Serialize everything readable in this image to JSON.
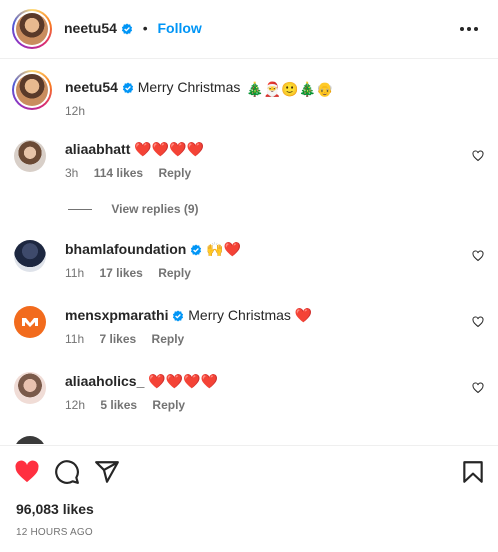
{
  "header": {
    "username": "neetu54",
    "separator": "•",
    "follow_label": "Follow",
    "more_icon": "more-horizontal-icon"
  },
  "caption": {
    "username": "neetu54",
    "text": "Merry Christmas",
    "emojis": "🎄🎅🙂🎄👴",
    "time": "12h"
  },
  "comments": [
    {
      "username": "aliaabhatt",
      "text": "❤️❤️❤️❤️",
      "time": "3h",
      "likes": "114 likes",
      "reply": "Reply"
    },
    {
      "username": "bhamlafoundation",
      "verified": true,
      "text": "🙌❤️",
      "time": "11h",
      "likes": "17 likes",
      "reply": "Reply"
    },
    {
      "username": "mensxpmarathi",
      "verified": true,
      "text": "Merry Christmas ❤️",
      "time": "11h",
      "likes": "7 likes",
      "reply": "Reply"
    },
    {
      "username": "aliaaholics_",
      "text": "❤️❤️❤️❤️",
      "time": "12h",
      "likes": "5 likes",
      "reply": "Reply"
    }
  ],
  "view_replies": "View replies (9)",
  "actions": {
    "like_icon": "heart-filled-icon",
    "comment_icon": "comment-icon",
    "share_icon": "share-icon",
    "save_icon": "bookmark-icon",
    "like_color": "#ff3040"
  },
  "likes_count": "96,083 likes",
  "time_ago": "12 HOURS AGO",
  "colors": {
    "accent": "#0095f6",
    "muted": "#737373",
    "heart": "#ed4956"
  }
}
